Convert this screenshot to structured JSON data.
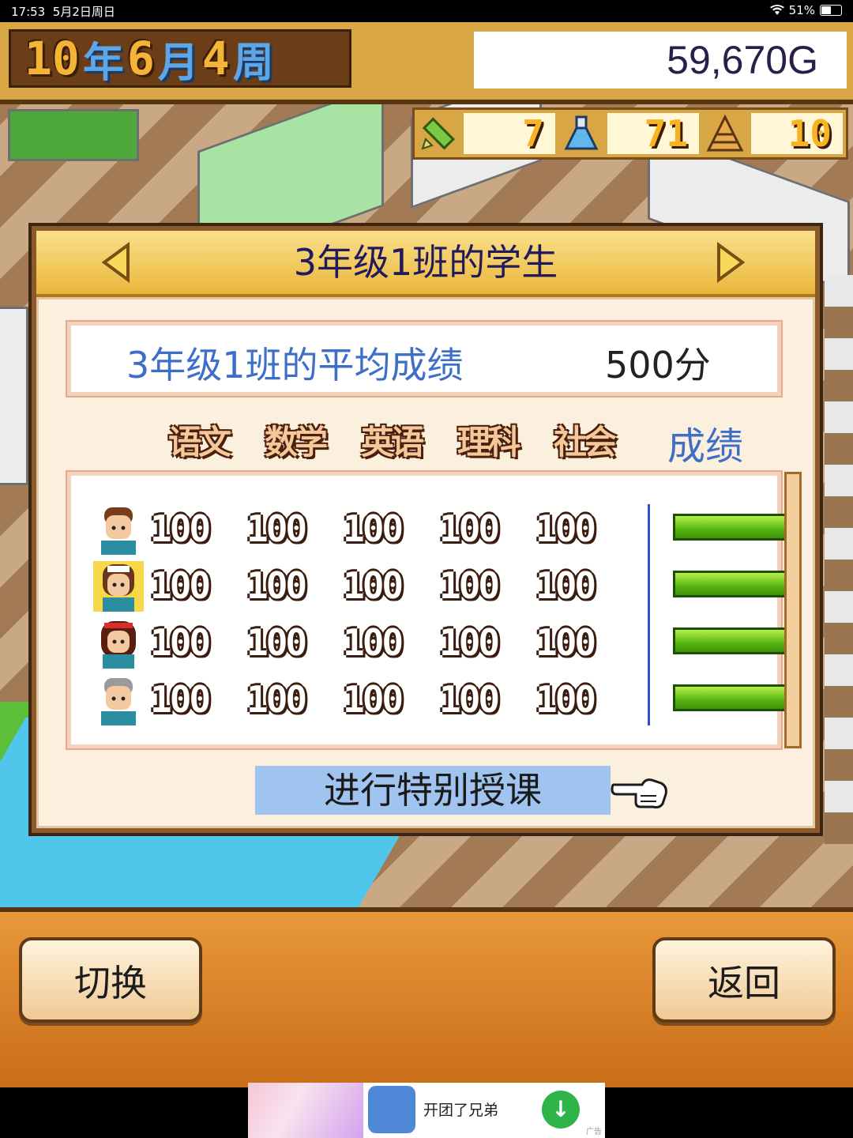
{
  "status_bar": {
    "time": "17:53",
    "date": "5月2日周日",
    "battery": "51%"
  },
  "date": {
    "year": "10",
    "year_unit": "年",
    "month": "6",
    "month_unit": "月",
    "week": "4",
    "week_unit": "周"
  },
  "money": "59,670G",
  "stats": [
    {
      "icon": "pencil-icon",
      "value": "7"
    },
    {
      "icon": "flask-icon",
      "value": "71"
    },
    {
      "icon": "pyramid-icon",
      "value": "10"
    }
  ],
  "panel": {
    "title": "3年级1班的学生",
    "average_label": "3年级1班的平均成绩",
    "average_value": "500分",
    "subjects": [
      "语文",
      "数学",
      "英语",
      "理科",
      "社会"
    ],
    "score_header": "成绩",
    "students": [
      {
        "scores": [
          "100",
          "100",
          "100",
          "100",
          "100"
        ],
        "grade_fill": 1.0
      },
      {
        "scores": [
          "100",
          "100",
          "100",
          "100",
          "100"
        ],
        "grade_fill": 1.0
      },
      {
        "scores": [
          "100",
          "100",
          "100",
          "100",
          "100"
        ],
        "grade_fill": 1.0
      },
      {
        "scores": [
          "100",
          "100",
          "100",
          "100",
          "100"
        ],
        "grade_fill": 1.0
      }
    ],
    "special_button": "进行特别授课"
  },
  "buttons": {
    "switch": "切换",
    "back": "返回"
  },
  "ad": {
    "text": "开团了兄弟",
    "tag": "广告"
  },
  "colors": {
    "accent_blue": "#3d6fc8",
    "gold": "#d8a645",
    "grade_bar": "#56b511"
  }
}
